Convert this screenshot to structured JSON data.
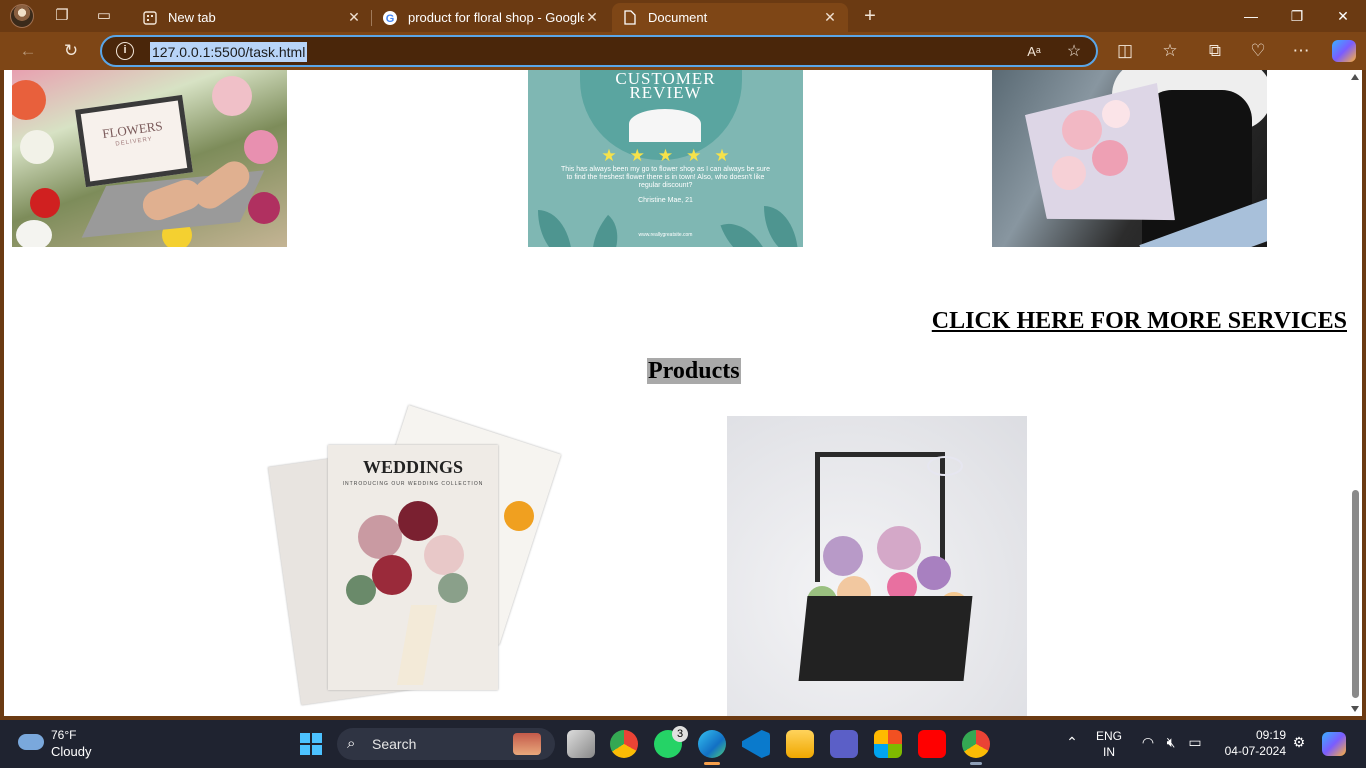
{
  "browser": {
    "tabs": [
      {
        "title": "New tab",
        "icon": "newtab-icon"
      },
      {
        "title": "product for floral shop - Google",
        "icon": "google-icon"
      },
      {
        "title": "Document",
        "icon": "document-icon"
      }
    ],
    "address": {
      "url": "127.0.0.1:5500/task.html"
    }
  },
  "page": {
    "services_images": [
      {
        "alt": "Flowers delivery laptop",
        "laptop_title": "FLOWERS",
        "laptop_subtitle": "DELIVERY"
      },
      {
        "alt": "Customer review card",
        "title_line1": "CUSTOMER",
        "title_line2": "REVIEW",
        "stars": "★★★★★",
        "text": "This has always been my go to flower shop as I can always be sure to find the freshest flower there is in town! Also, who doesn't like regular discount?",
        "name": "Christine Mae, 21",
        "url": "www.reallygreatsite.com"
      },
      {
        "alt": "Florist handing a bouquet"
      }
    ],
    "more_services_link": "CLICK HERE FOR MORE SERVICES",
    "products_heading": "Products",
    "products": [
      {
        "alt": "Weddings magazine bouquet",
        "magazine_title": "WEDDINGS",
        "magazine_subtitle": "INTRODUCING OUR WEDDING COLLECTION"
      },
      {
        "alt": "Flower box arrangement"
      }
    ]
  },
  "taskbar": {
    "weather": {
      "temp": "76°F",
      "desc": "Cloudy"
    },
    "search_label": "Search",
    "whatsapp_badge": "3",
    "language": {
      "line1": "ENG",
      "line2": "IN"
    },
    "clock": {
      "time": "09:19",
      "date": "04-07-2024"
    }
  }
}
